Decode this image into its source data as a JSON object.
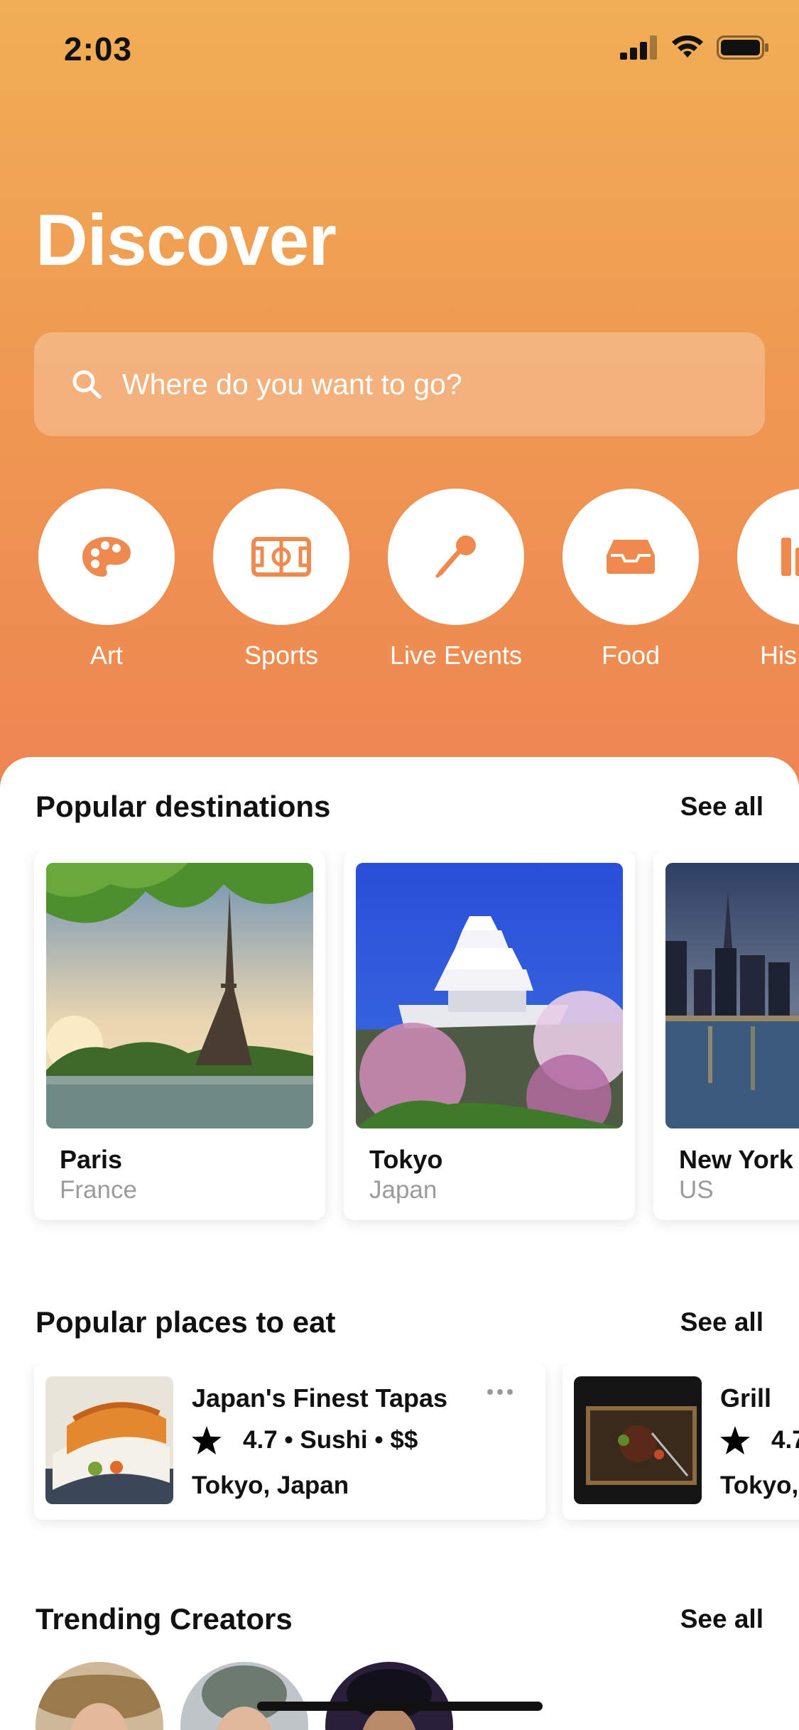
{
  "status_bar": {
    "time": "2:03"
  },
  "header": {
    "title": "Discover"
  },
  "search": {
    "placeholder": "Where do you want to go?"
  },
  "categories": [
    {
      "label": "Art",
      "icon": "palette-icon"
    },
    {
      "label": "Sports",
      "icon": "field-icon"
    },
    {
      "label": "Live Events",
      "icon": "microphone-icon"
    },
    {
      "label": "Food",
      "icon": "tray-icon"
    },
    {
      "label": "His",
      "icon": "history-icon"
    }
  ],
  "popular_destinations": {
    "title": "Popular destinations",
    "see_all": "See all",
    "items": [
      {
        "city": "Paris",
        "country": "France"
      },
      {
        "city": "Tokyo",
        "country": "Japan"
      },
      {
        "city": "New York",
        "country": "US"
      }
    ]
  },
  "popular_eat": {
    "title": "Popular places to eat",
    "see_all": "See all",
    "items": [
      {
        "name": "Japan's Finest Tapas",
        "rating": "4.7 • Sushi • $$",
        "location": "Tokyo, Japan"
      },
      {
        "name": "Grill",
        "rating": "4.7",
        "location": "Tokyo,"
      }
    ]
  },
  "trending_creators": {
    "title": "Trending Creators",
    "see_all": "See all"
  },
  "colors": {
    "accent": "#EF9A52",
    "accent_top": "#F1AE55",
    "accent_bottom": "#EE8552"
  }
}
